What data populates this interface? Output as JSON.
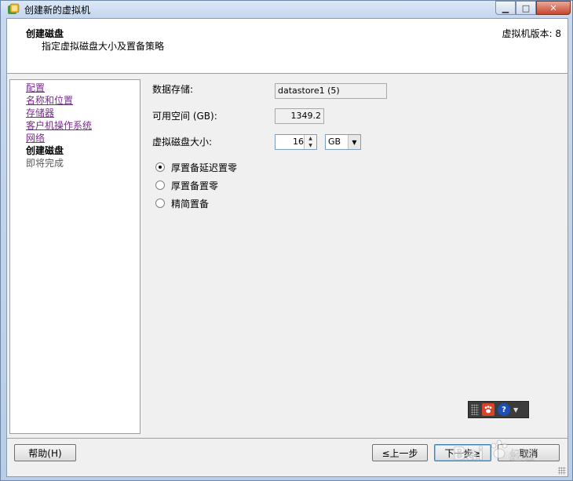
{
  "window": {
    "title": "创建新的虚拟机"
  },
  "header": {
    "title": "创建磁盘",
    "subtitle": "指定虚拟磁盘大小及置备策略",
    "version": "虚拟机版本: 8"
  },
  "sidebar": {
    "items": [
      {
        "label": "配置",
        "state": "link"
      },
      {
        "label": "名称和位置",
        "state": "link"
      },
      {
        "label": "存储器",
        "state": "link"
      },
      {
        "label": "客户机操作系统",
        "state": "link"
      },
      {
        "label": "网络",
        "state": "link"
      },
      {
        "label": "创建磁盘",
        "state": "current"
      },
      {
        "label": "即将完成",
        "state": "pending"
      }
    ]
  },
  "form": {
    "datastore_label": "数据存储:",
    "datastore_value": "datastore1 (5)",
    "free_space_label": "可用空间 (GB):",
    "free_space_value": "1349.2",
    "disk_size_label": "虚拟磁盘大小:",
    "disk_size_value": "16",
    "disk_size_unit": "GB",
    "provisioning": {
      "options": [
        {
          "label": "厚置备延迟置零",
          "selected": true
        },
        {
          "label": "厚置备置零",
          "selected": false
        },
        {
          "label": "精简置备",
          "selected": false
        }
      ]
    }
  },
  "footer": {
    "help_label": "帮助(H)",
    "back_label": "≤上一步",
    "next_label": "下一步≥",
    "cancel_label": "取消"
  },
  "icons": {
    "app": "vsphere-app-icon",
    "toolbar": [
      "grip-icon",
      "paw-icon",
      "help-icon",
      "dropdown-icon"
    ]
  },
  "colors": {
    "visited_link": "#7a2a8f",
    "close_button": "#c7452c"
  }
}
